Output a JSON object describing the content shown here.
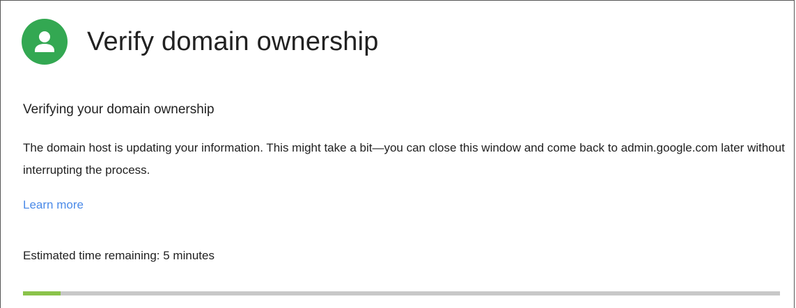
{
  "header": {
    "title": "Verify domain ownership",
    "avatar_icon": "person-icon",
    "avatar_color": "#33a852"
  },
  "main": {
    "heading": "Verifying your domain ownership",
    "description": "The domain host is updating your information. This might take a bit—you can close this window and come back to admin.google.com later without interrupting the process.",
    "learn_more_label": "Learn more",
    "estimate_text": "Estimated time remaining: 5 minutes"
  },
  "progress": {
    "fraction": 0.05,
    "fill_color": "#8bc34a",
    "track_color": "#c8c8c8"
  }
}
